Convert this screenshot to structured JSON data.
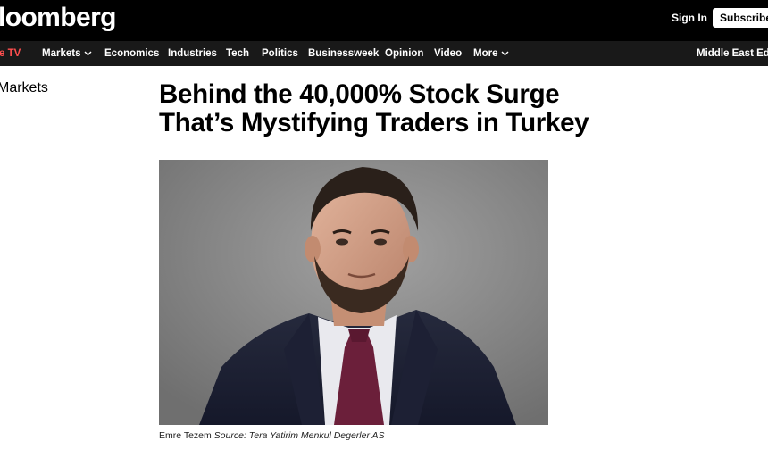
{
  "header": {
    "logo_text": "loomberg",
    "signin_label": "Sign In",
    "subscribe_label": "Subscribe"
  },
  "nav": {
    "items": [
      {
        "label": "e TV"
      },
      {
        "label": "Markets"
      },
      {
        "label": "Economics"
      },
      {
        "label": "Industries"
      },
      {
        "label": "Tech"
      },
      {
        "label": "Politics"
      },
      {
        "label": "Businessweek"
      },
      {
        "label": "Opinion"
      },
      {
        "label": "Video"
      },
      {
        "label": "More"
      },
      {
        "label": "Middle East Editi"
      }
    ]
  },
  "article": {
    "section": "Markets",
    "headline_line1": "Behind the 40,000% Stock Surge",
    "headline_line2": "That’s Mystifying Traders in Turkey",
    "caption_name": "Emre Tezem",
    "caption_source": "Source: Tera Yatirim Menkul Degerler AS"
  },
  "colors": {
    "topbar": "#000000",
    "navbar": "#191919",
    "live_tv": "#ff4f4f",
    "photo_bg": "#8a8a8a"
  }
}
